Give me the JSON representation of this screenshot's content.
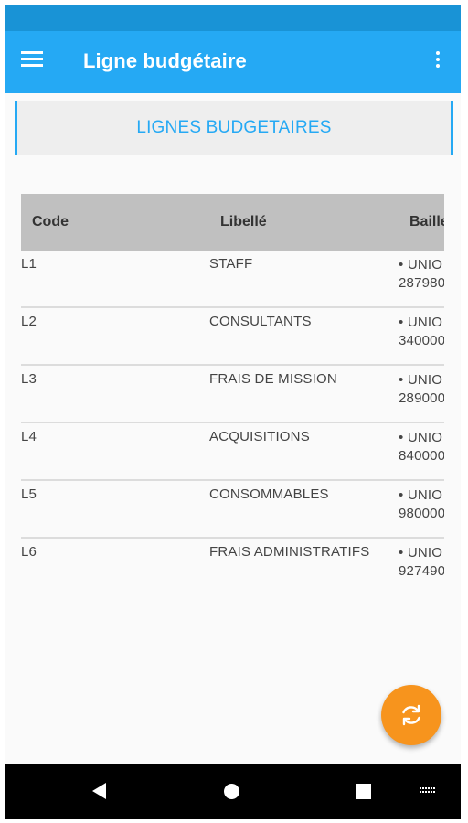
{
  "appbar": {
    "title": "Ligne budgétaire"
  },
  "section": {
    "label": "LIGNES BUDGETAIRES"
  },
  "table": {
    "headers": [
      "Code",
      "Libellé",
      "Baille"
    ],
    "rows": [
      {
        "code": "L1",
        "libelle": "STAFF",
        "bail1": "• UNIO",
        "bail2": "287980"
      },
      {
        "code": "L2",
        "libelle": "CONSULTANTS",
        "bail1": "• UNIO",
        "bail2": "340000"
      },
      {
        "code": "L3",
        "libelle": "FRAIS DE MISSION",
        "bail1": "• UNIO",
        "bail2": "289000"
      },
      {
        "code": "L4",
        "libelle": "ACQUISITIONS",
        "bail1": "• UNIO",
        "bail2": "840000"
      },
      {
        "code": "L5",
        "libelle": "CONSOMMABLES",
        "bail1": "• UNIO",
        "bail2": "980000"
      },
      {
        "code": "L6",
        "libelle": "FRAIS ADMINISTRATIFS",
        "bail1": "• UNIO",
        "bail2": "927490"
      }
    ]
  },
  "icons": {
    "menu": "menu-icon",
    "overflow": "more-vert-icon",
    "fab": "refresh-icon",
    "nav": [
      "back-icon",
      "home-icon",
      "recents-icon",
      "keyboard-icon"
    ]
  },
  "colors": {
    "statusbar": "#1993d6",
    "appbar": "#25a9f4",
    "accent": "#25a9f4",
    "fab": "#f7941d"
  }
}
